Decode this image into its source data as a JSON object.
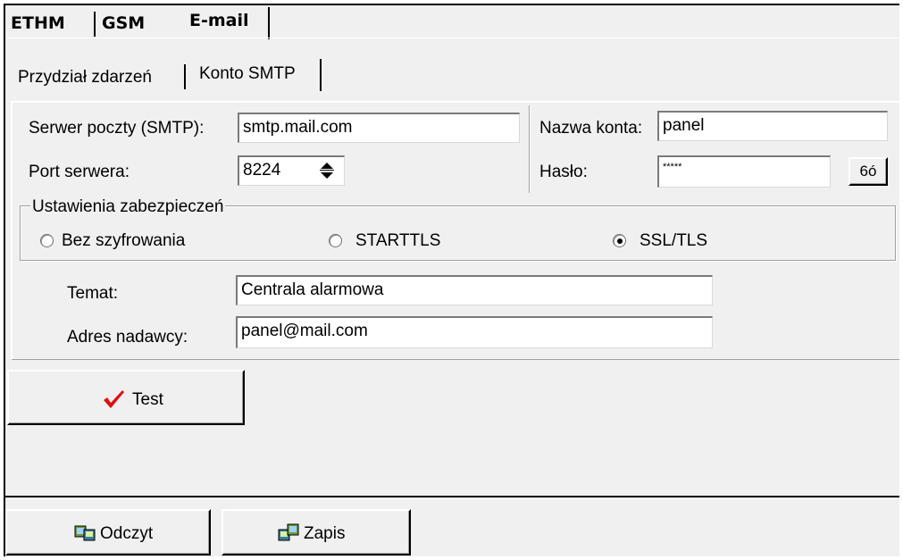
{
  "tabs": {
    "ethm": "ETHM",
    "gsm": "GSM",
    "email": "E-mail"
  },
  "subtabs": {
    "events": "Przydział zdarzeń",
    "smtp": "Konto SMTP"
  },
  "smtp": {
    "server_label": "Serwer poczty (SMTP):",
    "server_value": "smtp.mail.com",
    "port_label": "Port serwera:",
    "port_value": "8224",
    "account_label": "Nazwa konta:",
    "account_value": "panel",
    "password_label": "Hasło:",
    "password_value": "*****",
    "reveal_label": "6ó"
  },
  "security": {
    "title": "Ustawienia zabezpieczeń",
    "options": [
      "Bez szyfrowania",
      "STARTTLS",
      "SSL/TLS"
    ],
    "selected": "SSL/TLS"
  },
  "message": {
    "subject_label": "Temat:",
    "subject_value": "Centrala alarmowa",
    "sender_label": "Adres nadawcy:",
    "sender_value": "panel@mail.com"
  },
  "buttons": {
    "test": "Test",
    "read": "Odczyt",
    "write": "Zapis"
  },
  "colors": {
    "check": "#e01010",
    "panel_bg": "#f0f0f0"
  }
}
